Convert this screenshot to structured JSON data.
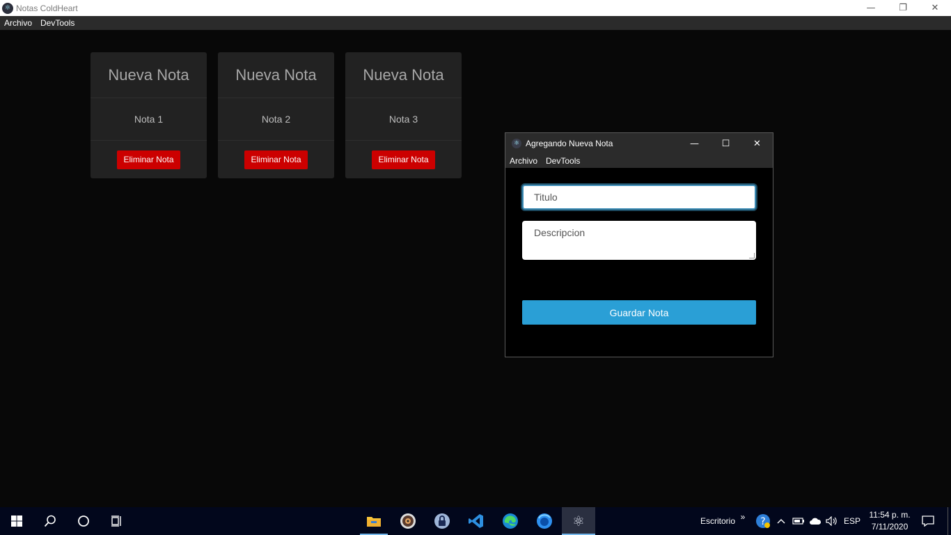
{
  "main_window": {
    "title": "Notas ColdHeart",
    "menu": [
      "Archivo",
      "DevTools"
    ],
    "controls": {
      "minimize": "—",
      "restore": "❐",
      "close": "✕"
    }
  },
  "notes": [
    {
      "title": "Nueva Nota",
      "description": "Nota 1",
      "delete_label": "Eliminar Nota"
    },
    {
      "title": "Nueva Nota",
      "description": "Nota 2",
      "delete_label": "Eliminar Nota"
    },
    {
      "title": "Nueva Nota",
      "description": "Nota 3",
      "delete_label": "Eliminar Nota"
    }
  ],
  "new_note_window": {
    "title": "Agregando Nueva Nota",
    "menu": [
      "Archivo",
      "DevTools"
    ],
    "controls": {
      "minimize": "—",
      "maximize": "☐",
      "close": "✕"
    },
    "title_placeholder": "Titulo",
    "description_placeholder": "Descripcion",
    "save_label": "Guardar Nota"
  },
  "taskbar": {
    "desktop_label": "Escritorio",
    "chevron": "»",
    "language": "ESP",
    "time": "11:54 p. m.",
    "date": "7/11/2020"
  },
  "colors": {
    "background": "#080808",
    "card": "#222222",
    "delete_button": "#cc0000",
    "save_button": "#2a9fd6",
    "taskbar": "#02071c"
  }
}
